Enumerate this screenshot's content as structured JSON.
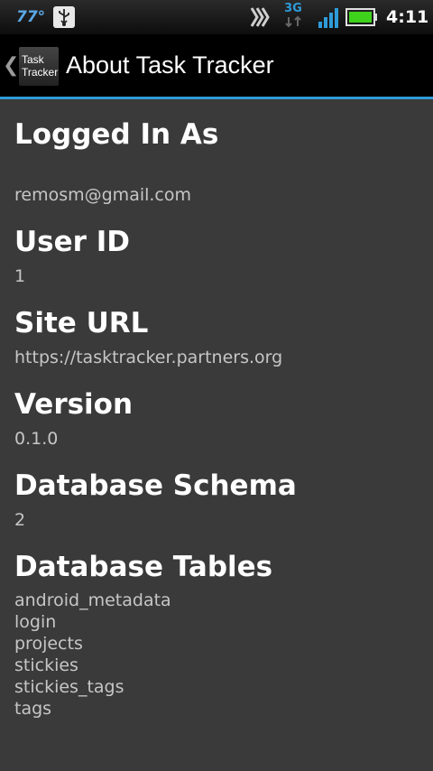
{
  "status_bar": {
    "temperature": "77°",
    "network_type": "3G",
    "time": "4:11",
    "icons": [
      "usb-icon",
      "signal-arrows-icon",
      "network-activity-icon",
      "signal-bars-icon",
      "battery-icon"
    ]
  },
  "action_bar": {
    "app_icon_line1": "Task",
    "app_icon_line2": "Tracker",
    "title": "About Task Tracker",
    "accent_color": "#2e9bd8"
  },
  "sections": {
    "logged_in": {
      "heading": "Logged In As",
      "value": "remosm@gmail.com"
    },
    "user_id": {
      "heading": "User ID",
      "value": "1"
    },
    "site_url": {
      "heading": "Site URL",
      "value": "https://tasktracker.partners.org"
    },
    "version": {
      "heading": "Version",
      "value": "0.1.0"
    },
    "db_schema": {
      "heading": "Database Schema",
      "value": "2"
    },
    "db_tables": {
      "heading": "Database Tables",
      "items": [
        "android_metadata",
        "login",
        "projects",
        "stickies",
        "stickies_tags",
        "tags"
      ]
    }
  }
}
